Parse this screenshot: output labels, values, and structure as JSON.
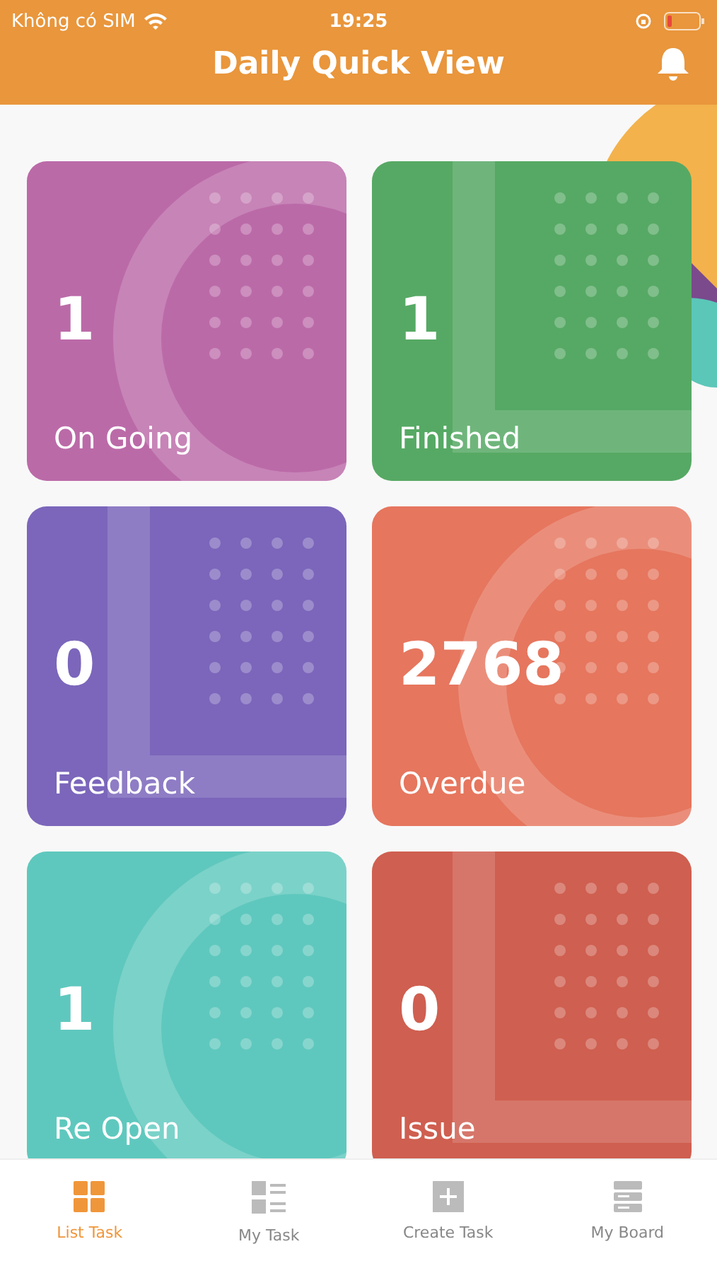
{
  "status_bar": {
    "carrier": "Không có SIM",
    "time": "19:25"
  },
  "header": {
    "title": "Daily Quick View"
  },
  "cards": [
    {
      "count": "1",
      "label": "On Going",
      "color": "#bb6aa8",
      "kind": "ring"
    },
    {
      "count": "1",
      "label": "Finished",
      "color": "#56a964",
      "kind": "corner"
    },
    {
      "count": "0",
      "label": "Feedback",
      "color": "#7b66bb",
      "kind": "corner"
    },
    {
      "count": "2768",
      "label": "Overdue",
      "color": "#e6765e",
      "kind": "ring"
    },
    {
      "count": "1",
      "label": "Re Open",
      "color": "#5fc8be",
      "kind": "ring"
    },
    {
      "count": "0",
      "label": "Issue",
      "color": "#cf5f50",
      "kind": "corner"
    }
  ],
  "tabs": [
    {
      "label": "List Task",
      "selected": true
    },
    {
      "label": "My Task",
      "selected": false
    },
    {
      "label": "Create Task",
      "selected": false
    },
    {
      "label": "My Board",
      "selected": false
    }
  ]
}
